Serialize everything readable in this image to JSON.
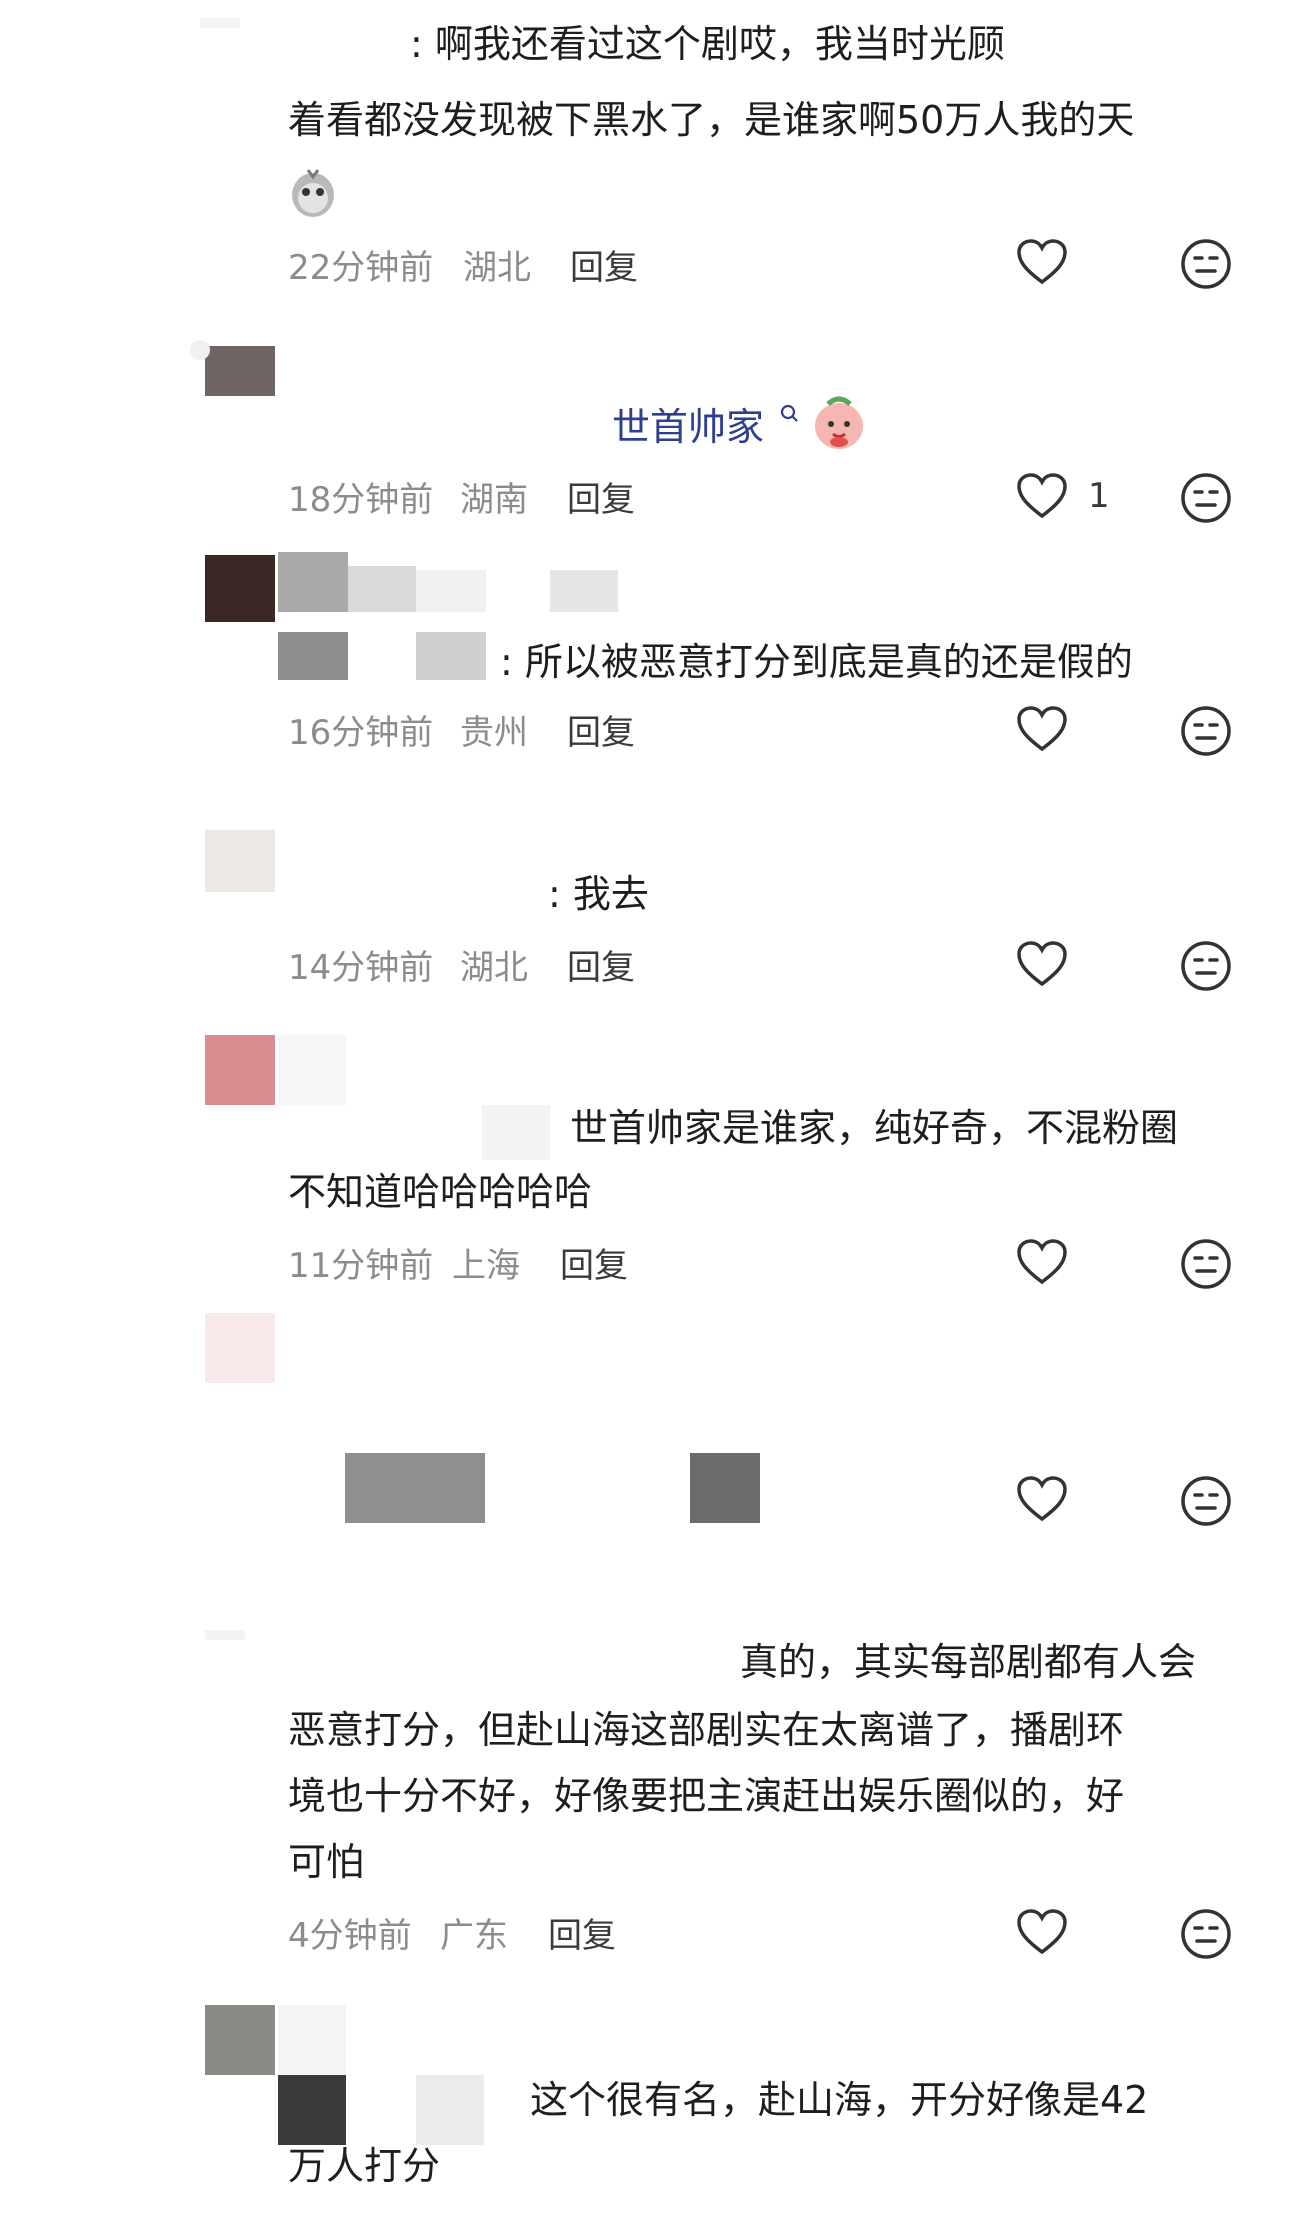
{
  "comments": [
    {
      "text_lines": [
        ": 啊我还看过这个剧哎，我当时光顾",
        "着看都没发现被下黑水了，是谁家啊50万人我的天"
      ],
      "time": "22分钟前",
      "region": "湖北",
      "reply_label": "回复",
      "like_count": ""
    },
    {
      "text_lines": [
        "世首帅家"
      ],
      "time": "18分钟前",
      "region": "湖南",
      "reply_label": "回复",
      "like_count": "1"
    },
    {
      "text_lines": [
        ": 所以被恶意打分到底是真的还是假的"
      ],
      "time": "16分钟前",
      "region": "贵州",
      "reply_label": "回复",
      "like_count": ""
    },
    {
      "text_lines": [
        ": 我去"
      ],
      "time": "14分钟前",
      "region": "湖北",
      "reply_label": "回复",
      "like_count": ""
    },
    {
      "text_lines": [
        "世首帅家是谁家，纯好奇，不混粉圈",
        "不知道哈哈哈哈哈"
      ],
      "time": "11分钟前",
      "region": "上海",
      "reply_label": "回复",
      "like_count": ""
    },
    {
      "text_lines": [],
      "time": "",
      "region": "",
      "reply_label": "",
      "like_count": ""
    },
    {
      "text_lines": [
        "真的，其实每部剧都有人会",
        "恶意打分，但赴山海这部剧实在太离谱了，播剧环",
        "境也十分不好，好像要把主演赶出娱乐圈似的，好",
        "可怕"
      ],
      "time": "4分钟前",
      "region": "广东",
      "reply_label": "回复",
      "like_count": ""
    },
    {
      "text_lines": [
        "这个很有名，赴山海，开分好像是42",
        "万人打分"
      ],
      "time": "",
      "region": "",
      "reply_label": "",
      "like_count": ""
    }
  ],
  "icons": {
    "like": "heart-outline-icon",
    "dislike": "neutral-face-icon"
  },
  "colors": {
    "text": "#1e1e1e",
    "meta": "#8c8c8c",
    "username_blue": "#2e3f8f"
  }
}
